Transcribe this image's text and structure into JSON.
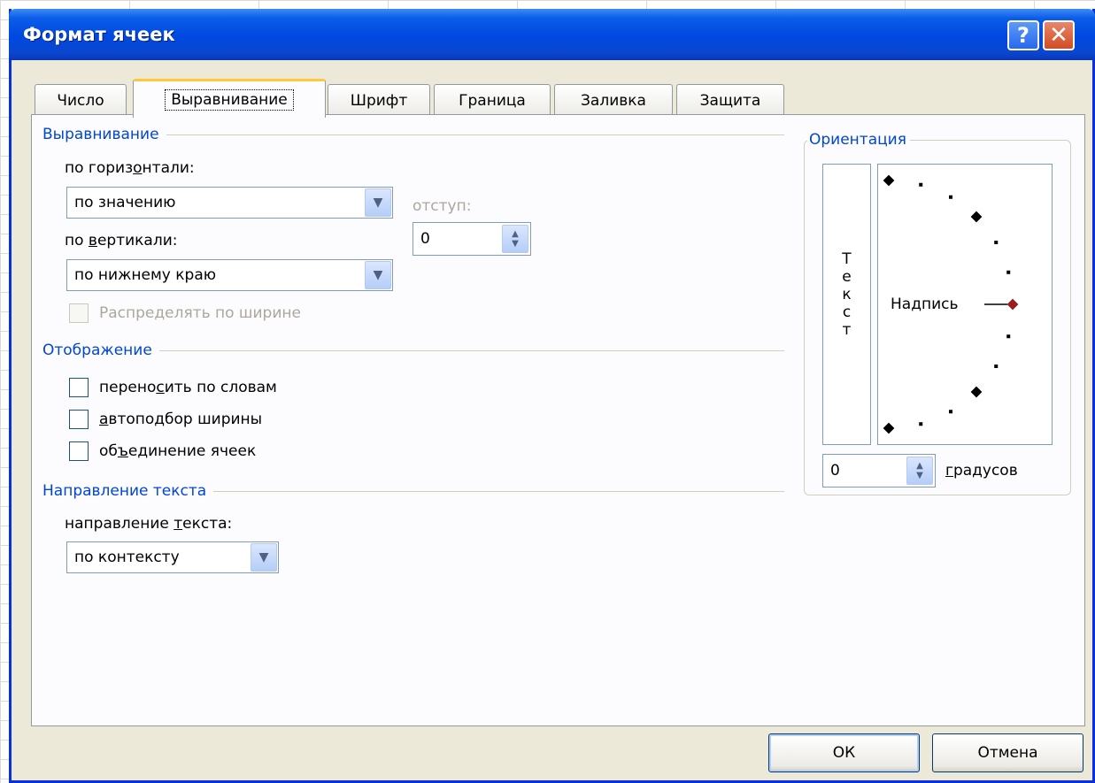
{
  "window": {
    "title": "Формат ячеек",
    "help_glyph": "?",
    "close_glyph": "✕"
  },
  "tabs": [
    {
      "label": "Число",
      "active": false
    },
    {
      "label": "Выравнивание",
      "active": true
    },
    {
      "label": "Шрифт",
      "active": false
    },
    {
      "label": "Граница",
      "active": false
    },
    {
      "label": "Заливка",
      "active": false
    },
    {
      "label": "Защита",
      "active": false
    }
  ],
  "alignment": {
    "group_title": "Выравнивание",
    "horizontal": {
      "label_pre": "по гориз",
      "label_hot": "о",
      "label_post": "нтали:",
      "value": "по значению"
    },
    "indent": {
      "label": "отступ:",
      "value": "0"
    },
    "vertical": {
      "label_pre": "по ",
      "label_hot": "в",
      "label_post": "ертикали:",
      "value": "по нижнему краю"
    },
    "justify_distributed": {
      "label": "Распределять по ширине",
      "checked": false,
      "enabled": false
    }
  },
  "display": {
    "group_title": "Отображение",
    "wrap_text": {
      "label_pre": "перено",
      "label_hot": "с",
      "label_post": "ить по словам",
      "checked": false
    },
    "shrink_to_fit": {
      "label_pre": "",
      "label_hot": "а",
      "label_post": "втоподбор ширины",
      "checked": false
    },
    "merge_cells": {
      "label_pre": "об",
      "label_hot": "ъ",
      "label_post": "единение ячеек",
      "checked": false
    }
  },
  "text_direction": {
    "group_title": "Направление текста",
    "label_pre": "направление ",
    "label_hot": "т",
    "label_post": "екста:",
    "value": "по контексту"
  },
  "orientation": {
    "group_title": "Ориентация",
    "vertical_text": [
      "Т",
      "е",
      "к",
      "с",
      "т"
    ],
    "dial_label": "Надпись",
    "degrees_value": "0",
    "degrees_label_hot": "г",
    "degrees_label_post": "радусов",
    "angle_degrees": 0,
    "colors": {
      "marker": "#9b1c1c"
    }
  },
  "buttons": {
    "ok": "ОК",
    "cancel": "Отмена"
  },
  "glyphs": {
    "dropdown": "▼",
    "spin_up": "▲",
    "spin_down": "▼"
  }
}
